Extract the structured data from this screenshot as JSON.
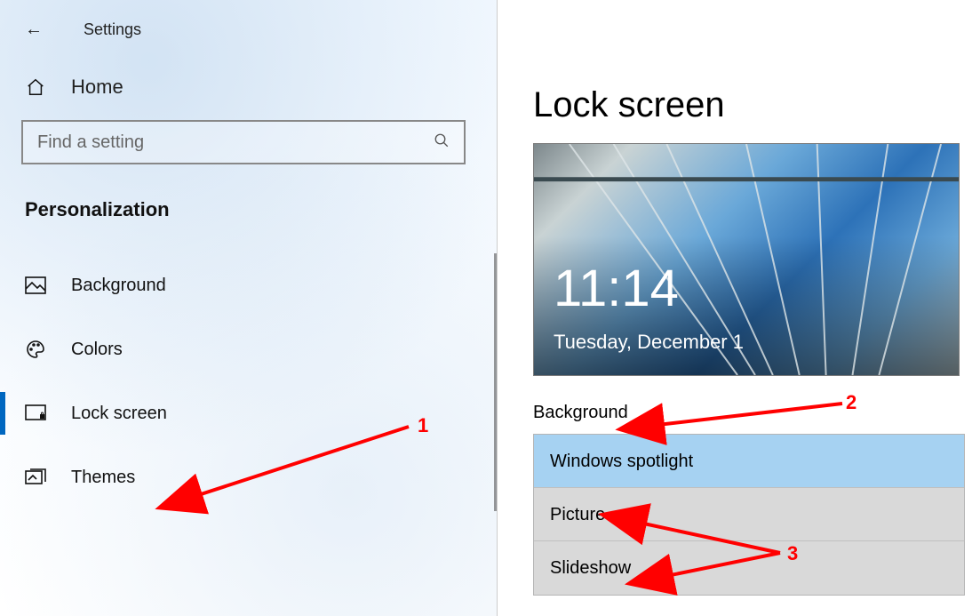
{
  "app_title": "Settings",
  "home_label": "Home",
  "search": {
    "placeholder": "Find a setting"
  },
  "category": "Personalization",
  "sidebar": {
    "items": [
      {
        "label": "Background"
      },
      {
        "label": "Colors"
      },
      {
        "label": "Lock screen"
      },
      {
        "label": "Themes"
      }
    ]
  },
  "page": {
    "title": "Lock screen",
    "preview": {
      "time": "11:14",
      "date": "Tuesday, December 1"
    },
    "background_label": "Background",
    "background_options": [
      {
        "label": "Windows spotlight"
      },
      {
        "label": "Picture"
      },
      {
        "label": "Slideshow"
      }
    ]
  },
  "annotations": {
    "a1": "1",
    "a2": "2",
    "a3": "3"
  }
}
